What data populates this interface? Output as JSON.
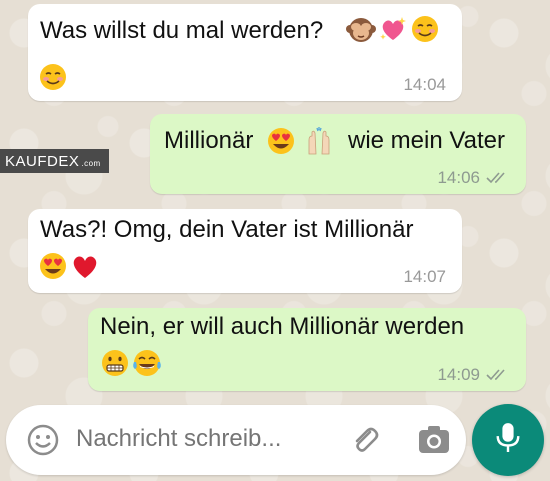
{
  "watermark": {
    "brand": "KAUFDEX",
    "domain": ".com"
  },
  "messages": [
    {
      "direction": "in",
      "text": "Was willst du mal werden?",
      "emojis_inline": [
        "see-no-evil-monkey",
        "sparkling-heart",
        "smiling-face"
      ],
      "emojis_line2": [
        "smiling-face"
      ],
      "time": "14:04"
    },
    {
      "direction": "out",
      "text_before": "Millionär",
      "emojis_inline": [
        "heart-eyes-face",
        "raising-hands"
      ],
      "text_after": "wie mein Vater",
      "time": "14:06",
      "status": "read"
    },
    {
      "direction": "in",
      "text": "Was?! Omg, dein Vater ist Millionär",
      "emojis_line2": [
        "heart-eyes-face",
        "red-heart"
      ],
      "time": "14:07"
    },
    {
      "direction": "out",
      "text": "Nein, er will auch Millionär werden",
      "emojis_line2": [
        "grimacing-face",
        "tears-of-joy-face"
      ],
      "time": "14:09",
      "status": "read"
    }
  ],
  "composer": {
    "placeholder": "Nachricht schreib..."
  },
  "colors": {
    "incoming": "#ffffff",
    "outgoing": "#dcf8c6",
    "accent": "#0b8a79",
    "timestamp": "#8e9a90"
  }
}
